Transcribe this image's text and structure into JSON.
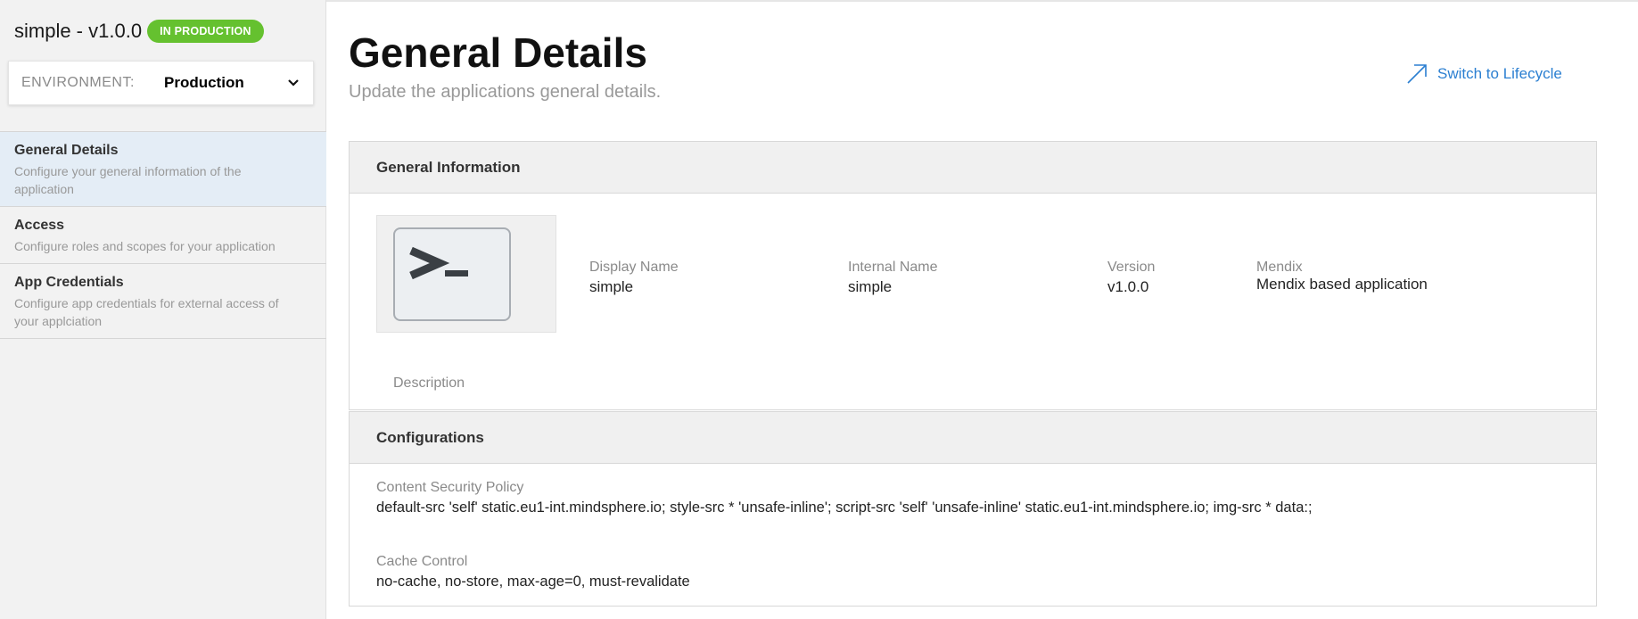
{
  "sidebar": {
    "app_title": "simple - v1.0.0",
    "status_badge": "IN PRODUCTION",
    "environment": {
      "label": "ENVIRONMENT:",
      "value": "Production"
    },
    "items": [
      {
        "title": "General Details",
        "desc": "Configure your general information of the application",
        "active": true
      },
      {
        "title": "Access",
        "desc": "Configure roles and scopes for your application",
        "active": false
      },
      {
        "title": "App Credentials",
        "desc": "Configure app credentials for external access of your applciation",
        "active": false
      }
    ]
  },
  "main": {
    "title": "General Details",
    "subtitle": "Update the applications general details.",
    "switch_link": "Switch to Lifecycle",
    "general_info": {
      "header": "General Information",
      "icon": "terminal-icon",
      "fields": [
        {
          "label": "Display Name",
          "value": "simple"
        },
        {
          "label": "Internal Name",
          "value": "simple"
        },
        {
          "label": "Version",
          "value": "v1.0.0"
        },
        {
          "label": "Mendix",
          "value": "Mendix based application"
        }
      ],
      "description_label": "Description"
    },
    "configurations": {
      "header": "Configurations",
      "csp_label": "Content Security Policy",
      "csp_value": "default-src 'self' static.eu1-int.mindsphere.io; style-src * 'unsafe-inline'; script-src 'self' 'unsafe-inline' static.eu1-int.mindsphere.io; img-src * data:;",
      "cache_label": "Cache Control",
      "cache_value": "no-cache, no-store, max-age=0, must-revalidate"
    }
  },
  "colors": {
    "badge_green": "#65c12f",
    "link_blue": "#2b7fd1",
    "active_nav": "#e4edf6"
  }
}
